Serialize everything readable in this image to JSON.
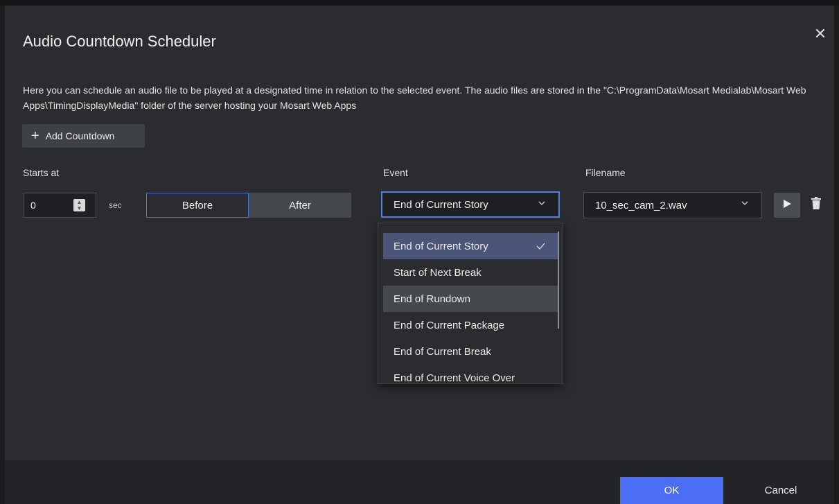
{
  "dialog": {
    "title": "Audio Countdown Scheduler",
    "close_icon": "close-icon",
    "description": "Here you can schedule an audio file to be played at a designated time in relation to the selected event. The audio files are stored in the \"C:\\ProgramData\\Mosart Medialab\\Mosart Web Apps\\TimingDisplayMedia\" folder of the server hosting your Mosart Web Apps"
  },
  "toolbar": {
    "add_label": "Add Countdown",
    "add_icon": "plus-icon"
  },
  "columns": {
    "starts_at": "Starts at",
    "event": "Event",
    "filename": "Filename"
  },
  "row": {
    "offset_value": "0",
    "unit": "sec",
    "before_label": "Before",
    "after_label": "After",
    "relation_selected": "Before",
    "event_selected": "End of Current Story",
    "filename_selected": "10_sec_cam_2.wav",
    "play_icon": "play-icon",
    "delete_icon": "trash-icon"
  },
  "event_options": [
    "End of Current Story",
    "Start of Next Break",
    "End of Rundown",
    "End of Current Package",
    "End of Current Break",
    "End of Current Voice Over"
  ],
  "footer": {
    "ok_label": "OK",
    "cancel_label": "Cancel"
  },
  "colors": {
    "accent": "#4b6ef5",
    "focus_border": "#5a7de5",
    "background": "#2a2c2f"
  }
}
